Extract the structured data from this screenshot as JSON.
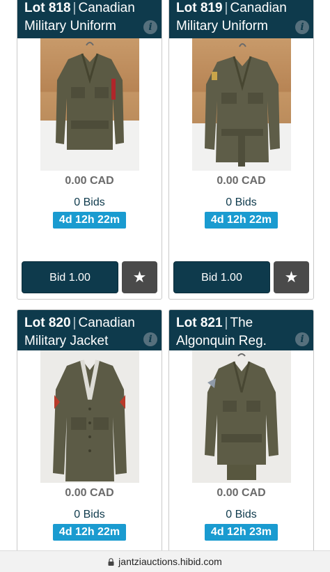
{
  "lots": [
    {
      "lot": "Lot 818",
      "separator": "|",
      "title": "Canadian Military Uniform",
      "price": "0.00 CAD",
      "bids": "0 Bids",
      "time_left": "4d 12h 22m",
      "bid_label": "Bid 1.00"
    },
    {
      "lot": "Lot 819",
      "separator": "|",
      "title": "Canadian Military Uniform",
      "price": "0.00 CAD",
      "bids": "0 Bids",
      "time_left": "4d 12h 22m",
      "bid_label": "Bid 1.00"
    },
    {
      "lot": "Lot 820",
      "separator": "|",
      "title": "Canadian Military Jacket",
      "price": "0.00 CAD",
      "bids": "0 Bids",
      "time_left": "4d 12h 22m"
    },
    {
      "lot": "Lot 821",
      "separator": "|",
      "title": "The Algonquin Reg.",
      "price": "0.00 CAD",
      "bids": "0 Bids",
      "time_left": "4d 12h 23m"
    }
  ],
  "browser": {
    "url": "jantziauctions.hibid.com"
  },
  "icons": {
    "info": "info-icon",
    "star": "star-icon",
    "lock": "lock-icon"
  },
  "colors": {
    "header": "#0e3a4c",
    "timer": "#1a9bd0",
    "watch_button": "#4a4a4a"
  }
}
